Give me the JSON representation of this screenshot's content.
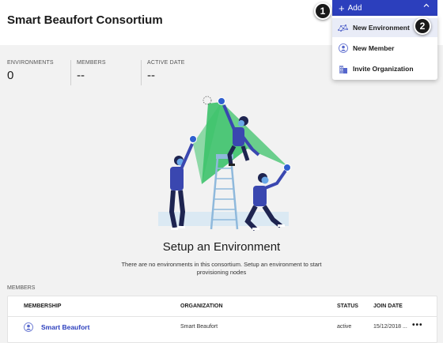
{
  "header": {
    "title": "Smart Beaufort Consortium"
  },
  "add_menu": {
    "button_label": "Add",
    "items": [
      {
        "label": "New Environment",
        "icon": "network-icon"
      },
      {
        "label": "New Member",
        "icon": "person-icon"
      },
      {
        "label": "Invite Organization",
        "icon": "buildings-icon"
      }
    ]
  },
  "callouts": [
    "1",
    "2"
  ],
  "stats": [
    {
      "label": "ENVIRONMENTS",
      "value": "0"
    },
    {
      "label": "MEMBERS",
      "value": "--"
    },
    {
      "label": "ACTIVE DATE",
      "value": "--"
    }
  ],
  "empty_state": {
    "title": "Setup an Environment",
    "description": "There are no environments in this consortium. Setup an environment to start provisioning nodes"
  },
  "members": {
    "section_label": "MEMBERS",
    "columns": [
      "MEMBERSHIP",
      "ORGANIZATION",
      "STATUS",
      "JOIN DATE"
    ],
    "rows": [
      {
        "membership": "Smart Beaufort",
        "organization": "Smart Beaufort",
        "status": "active",
        "join_date": "15/12/2018 ..."
      }
    ]
  },
  "colors": {
    "accent": "#2c3fbd",
    "illustration_green": "#3cc26a",
    "figure_blue": "#2f3a8f"
  }
}
